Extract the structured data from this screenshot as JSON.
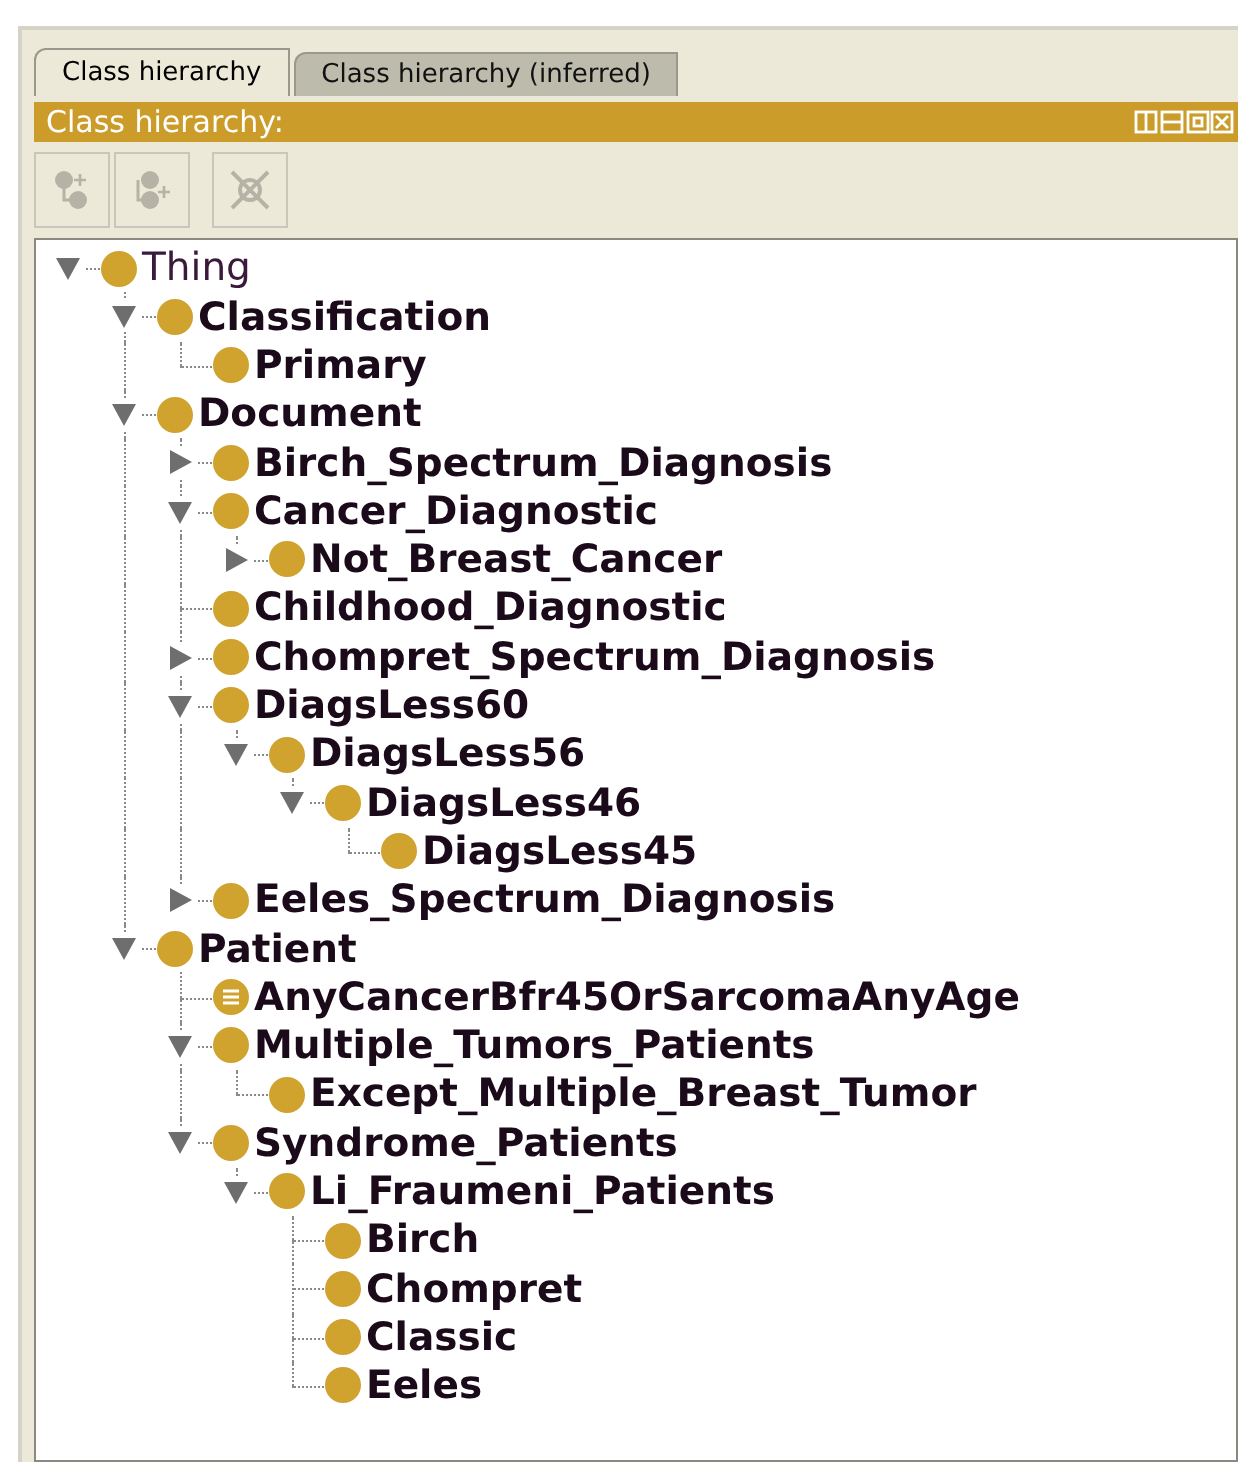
{
  "tabs": [
    {
      "label": "Class hierarchy",
      "selected": true
    },
    {
      "label": "Class hierarchy (inferred)",
      "selected": false
    }
  ],
  "view_header": {
    "title": "Class hierarchy:"
  },
  "toolbar": [
    {
      "kind": "add-subclass",
      "disabled": true
    },
    {
      "kind": "add-sibling",
      "disabled": true
    },
    {
      "kind": "delete",
      "disabled": true
    }
  ],
  "tree": [
    {
      "label": "Thing",
      "kind": "primitive",
      "bold": false,
      "has_children": true,
      "expanded": true,
      "children": [
        {
          "label": "Classification",
          "kind": "primitive",
          "bold": true,
          "has_children": true,
          "expanded": true,
          "children": [
            {
              "label": "Primary",
              "kind": "primitive",
              "bold": true,
              "has_children": false,
              "expanded": false
            }
          ]
        },
        {
          "label": "Document",
          "kind": "primitive",
          "bold": true,
          "has_children": true,
          "expanded": true,
          "children": [
            {
              "label": "Birch_Spectrum_Diagnosis",
              "kind": "primitive",
              "bold": true,
              "has_children": true,
              "expanded": false
            },
            {
              "label": "Cancer_Diagnostic",
              "kind": "primitive",
              "bold": true,
              "has_children": true,
              "expanded": true,
              "children": [
                {
                  "label": "Not_Breast_Cancer",
                  "kind": "primitive",
                  "bold": true,
                  "has_children": true,
                  "expanded": false
                }
              ]
            },
            {
              "label": "Childhood_Diagnostic",
              "kind": "primitive",
              "bold": true,
              "has_children": false,
              "expanded": false
            },
            {
              "label": "Chompret_Spectrum_Diagnosis",
              "kind": "primitive",
              "bold": true,
              "has_children": true,
              "expanded": false
            },
            {
              "label": "DiagsLess60",
              "kind": "primitive",
              "bold": true,
              "has_children": true,
              "expanded": true,
              "children": [
                {
                  "label": "DiagsLess56",
                  "kind": "primitive",
                  "bold": true,
                  "has_children": true,
                  "expanded": true,
                  "children": [
                    {
                      "label": "DiagsLess46",
                      "kind": "primitive",
                      "bold": true,
                      "has_children": true,
                      "expanded": true,
                      "children": [
                        {
                          "label": "DiagsLess45",
                          "kind": "primitive",
                          "bold": true,
                          "has_children": false,
                          "expanded": false
                        }
                      ]
                    }
                  ]
                }
              ]
            },
            {
              "label": "Eeles_Spectrum_Diagnosis",
              "kind": "primitive",
              "bold": true,
              "has_children": true,
              "expanded": false
            }
          ]
        },
        {
          "label": "Patient",
          "kind": "primitive",
          "bold": true,
          "has_children": true,
          "expanded": true,
          "children": [
            {
              "label": "AnyCancerBfr45OrSarcomaAnyAge",
              "kind": "defined",
              "bold": true,
              "has_children": false,
              "expanded": false
            },
            {
              "label": "Multiple_Tumors_Patients",
              "kind": "primitive",
              "bold": true,
              "has_children": true,
              "expanded": true,
              "children": [
                {
                  "label": "Except_Multiple_Breast_Tumor",
                  "kind": "primitive",
                  "bold": true,
                  "has_children": false,
                  "expanded": false
                }
              ]
            },
            {
              "label": "Syndrome_Patients",
              "kind": "primitive",
              "bold": true,
              "has_children": true,
              "expanded": true,
              "children": [
                {
                  "label": "Li_Fraumeni_Patients",
                  "kind": "primitive",
                  "bold": true,
                  "has_children": true,
                  "expanded": true,
                  "children": [
                    {
                      "label": "Birch",
                      "kind": "primitive",
                      "bold": true,
                      "has_children": false,
                      "expanded": false
                    },
                    {
                      "label": "Chompret",
                      "kind": "primitive",
                      "bold": true,
                      "has_children": false,
                      "expanded": false
                    },
                    {
                      "label": "Classic",
                      "kind": "primitive",
                      "bold": true,
                      "has_children": false,
                      "expanded": false
                    },
                    {
                      "label": "Eeles",
                      "kind": "primitive",
                      "bold": true,
                      "has_children": false,
                      "expanded": false
                    }
                  ]
                }
              ]
            }
          ]
        }
      ]
    }
  ]
}
